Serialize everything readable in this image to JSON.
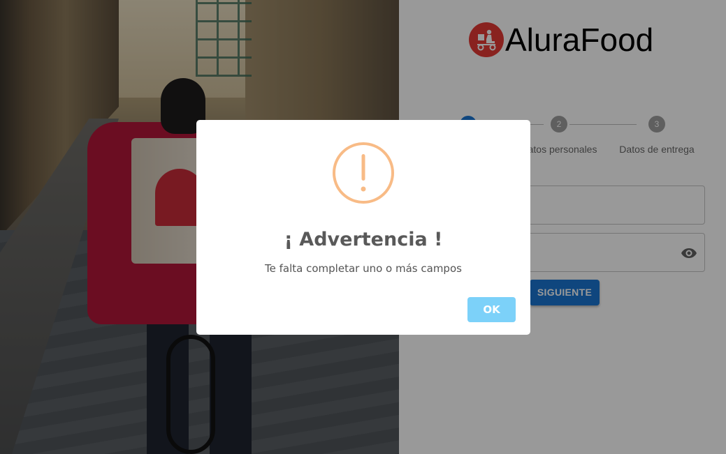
{
  "brand": {
    "name": "AluraFood",
    "icon": "delivery-scooter-icon",
    "color": "#e53935"
  },
  "stepper": {
    "steps": [
      {
        "number": "1",
        "label": "",
        "active": true
      },
      {
        "number": "2",
        "label": "Datos personales",
        "active": false
      },
      {
        "number": "3",
        "label": "Datos de entrega",
        "active": false
      }
    ],
    "active_color": "#1976d2",
    "inactive_color": "#9e9e9e"
  },
  "form": {
    "email_value": "",
    "password_value": "",
    "password_toggle_icon": "eye-icon",
    "next_label": "SIGUIENTE"
  },
  "modal": {
    "icon": "warning-icon",
    "icon_color": "#f8bb86",
    "title": "¡ Advertencia !",
    "text": "Te falta completar uno o más campos",
    "ok_label": "OK",
    "ok_color": "#7cd1f9"
  }
}
